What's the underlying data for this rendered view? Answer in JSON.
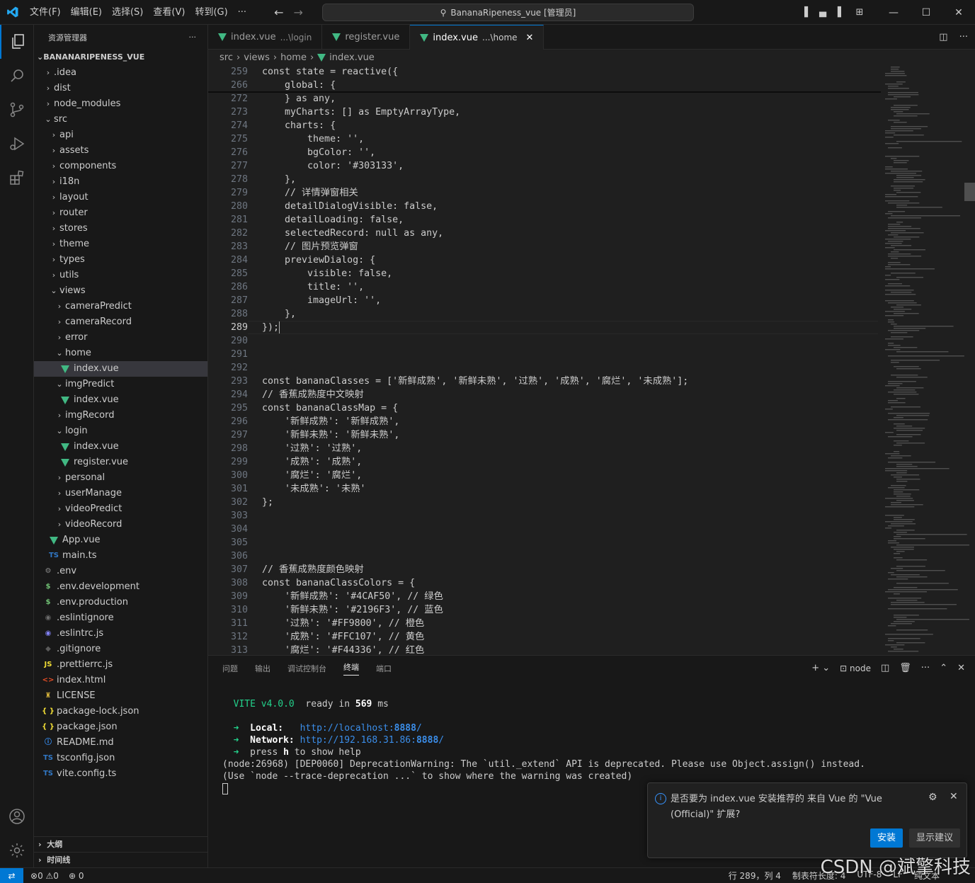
{
  "titlebar": {
    "menus": [
      "文件(F)",
      "编辑(E)",
      "选择(S)",
      "查看(V)",
      "转到(G)",
      "···"
    ],
    "search_text": "BananaRipeness_vue [管理员]"
  },
  "sidebar": {
    "title": "资源管理器",
    "more": "···",
    "root": "BANANARIPENESS_VUE",
    "tree": [
      {
        "label": ".idea",
        "depth": 1,
        "kind": "folder",
        "open": false
      },
      {
        "label": "dist",
        "depth": 1,
        "kind": "folder",
        "open": false
      },
      {
        "label": "node_modules",
        "depth": 1,
        "kind": "folder",
        "open": false
      },
      {
        "label": "src",
        "depth": 1,
        "kind": "folder",
        "open": true
      },
      {
        "label": "api",
        "depth": 2,
        "kind": "folder",
        "open": false
      },
      {
        "label": "assets",
        "depth": 2,
        "kind": "folder",
        "open": false
      },
      {
        "label": "components",
        "depth": 2,
        "kind": "folder",
        "open": false
      },
      {
        "label": "i18n",
        "depth": 2,
        "kind": "folder",
        "open": false
      },
      {
        "label": "layout",
        "depth": 2,
        "kind": "folder",
        "open": false
      },
      {
        "label": "router",
        "depth": 2,
        "kind": "folder",
        "open": false
      },
      {
        "label": "stores",
        "depth": 2,
        "kind": "folder",
        "open": false
      },
      {
        "label": "theme",
        "depth": 2,
        "kind": "folder",
        "open": false
      },
      {
        "label": "types",
        "depth": 2,
        "kind": "folder",
        "open": false
      },
      {
        "label": "utils",
        "depth": 2,
        "kind": "folder",
        "open": false
      },
      {
        "label": "views",
        "depth": 2,
        "kind": "folder",
        "open": true
      },
      {
        "label": "cameraPredict",
        "depth": 3,
        "kind": "folder",
        "open": false
      },
      {
        "label": "cameraRecord",
        "depth": 3,
        "kind": "folder",
        "open": false
      },
      {
        "label": "error",
        "depth": 3,
        "kind": "folder",
        "open": false
      },
      {
        "label": "home",
        "depth": 3,
        "kind": "folder",
        "open": true
      },
      {
        "label": "index.vue",
        "depth": 4,
        "kind": "vue",
        "selected": true
      },
      {
        "label": "imgPredict",
        "depth": 3,
        "kind": "folder",
        "open": true
      },
      {
        "label": "index.vue",
        "depth": 4,
        "kind": "vue"
      },
      {
        "label": "imgRecord",
        "depth": 3,
        "kind": "folder",
        "open": false
      },
      {
        "label": "login",
        "depth": 3,
        "kind": "folder",
        "open": true
      },
      {
        "label": "index.vue",
        "depth": 4,
        "kind": "vue"
      },
      {
        "label": "register.vue",
        "depth": 4,
        "kind": "vue"
      },
      {
        "label": "personal",
        "depth": 3,
        "kind": "folder",
        "open": false
      },
      {
        "label": "userManage",
        "depth": 3,
        "kind": "folder",
        "open": false
      },
      {
        "label": "videoPredict",
        "depth": 3,
        "kind": "folder",
        "open": false
      },
      {
        "label": "videoRecord",
        "depth": 3,
        "kind": "folder",
        "open": false
      },
      {
        "label": "App.vue",
        "depth": 2,
        "kind": "vue"
      },
      {
        "label": "main.ts",
        "depth": 2,
        "kind": "ts"
      },
      {
        "label": ".env",
        "depth": 1,
        "kind": "gear"
      },
      {
        "label": ".env.development",
        "depth": 1,
        "kind": "dollar"
      },
      {
        "label": ".env.production",
        "depth": 1,
        "kind": "dollar"
      },
      {
        "label": ".eslintignore",
        "depth": 1,
        "kind": "circle"
      },
      {
        "label": ".eslintrc.js",
        "depth": 1,
        "kind": "eslint"
      },
      {
        "label": ".gitignore",
        "depth": 1,
        "kind": "git"
      },
      {
        "label": ".prettierrc.js",
        "depth": 1,
        "kind": "js"
      },
      {
        "label": "index.html",
        "depth": 1,
        "kind": "html"
      },
      {
        "label": "LICENSE",
        "depth": 1,
        "kind": "license"
      },
      {
        "label": "package-lock.json",
        "depth": 1,
        "kind": "json"
      },
      {
        "label": "package.json",
        "depth": 1,
        "kind": "json"
      },
      {
        "label": "README.md",
        "depth": 1,
        "kind": "info"
      },
      {
        "label": "tsconfig.json",
        "depth": 1,
        "kind": "tsconfig"
      },
      {
        "label": "vite.config.ts",
        "depth": 1,
        "kind": "ts"
      }
    ],
    "outline": "大纲",
    "timeline": "时间线"
  },
  "tabs": [
    {
      "name": "index.vue",
      "hint": "...\\login",
      "active": false
    },
    {
      "name": "register.vue",
      "hint": "",
      "active": false
    },
    {
      "name": "index.vue",
      "hint": "...\\home",
      "active": true
    }
  ],
  "breadcrumb": [
    "src",
    "views",
    "home",
    "index.vue"
  ],
  "code": {
    "current_line": 289,
    "lines": [
      {
        "n": 259,
        "t": "const state = reactive({"
      },
      {
        "n": 266,
        "t": "    global: {"
      },
      {
        "n": 272,
        "t": "    } as any,"
      },
      {
        "n": 273,
        "t": "    myCharts: [] as EmptyArrayType,"
      },
      {
        "n": 274,
        "t": "    charts: {"
      },
      {
        "n": 275,
        "t": "        theme: '',"
      },
      {
        "n": 276,
        "t": "        bgColor: '',"
      },
      {
        "n": 277,
        "t": "        color: '#303133',"
      },
      {
        "n": 278,
        "t": "    },"
      },
      {
        "n": 279,
        "t": "    // 详情弹窗相关"
      },
      {
        "n": 280,
        "t": "    detailDialogVisible: false,"
      },
      {
        "n": 281,
        "t": "    detailLoading: false,"
      },
      {
        "n": 282,
        "t": "    selectedRecord: null as any,"
      },
      {
        "n": 283,
        "t": "    // 图片预览弹窗"
      },
      {
        "n": 284,
        "t": "    previewDialog: {"
      },
      {
        "n": 285,
        "t": "        visible: false,"
      },
      {
        "n": 286,
        "t": "        title: '',"
      },
      {
        "n": 287,
        "t": "        imageUrl: '',"
      },
      {
        "n": 288,
        "t": "    },"
      },
      {
        "n": 289,
        "t": "});"
      },
      {
        "n": 290,
        "t": ""
      },
      {
        "n": 291,
        "t": ""
      },
      {
        "n": 292,
        "t": ""
      },
      {
        "n": 293,
        "t": "const bananaClasses = ['新鲜成熟', '新鲜未熟', '过熟', '成熟', '腐烂', '未成熟'];"
      },
      {
        "n": 294,
        "t": "// 香蕉成熟度中文映射"
      },
      {
        "n": 295,
        "t": "const bananaClassMap = {"
      },
      {
        "n": 296,
        "t": "    '新鲜成熟': '新鲜成熟',"
      },
      {
        "n": 297,
        "t": "    '新鲜未熟': '新鲜未熟',"
      },
      {
        "n": 298,
        "t": "    '过熟': '过熟',"
      },
      {
        "n": 299,
        "t": "    '成熟': '成熟',"
      },
      {
        "n": 300,
        "t": "    '腐烂': '腐烂',"
      },
      {
        "n": 301,
        "t": "    '未成熟': '未熟'"
      },
      {
        "n": 302,
        "t": "};"
      },
      {
        "n": 303,
        "t": ""
      },
      {
        "n": 304,
        "t": ""
      },
      {
        "n": 305,
        "t": ""
      },
      {
        "n": 306,
        "t": ""
      },
      {
        "n": 307,
        "t": "// 香蕉成熟度颜色映射"
      },
      {
        "n": 308,
        "t": "const bananaClassColors = {"
      },
      {
        "n": 309,
        "t": "    '新鲜成熟': '#4CAF50', // 绿色"
      },
      {
        "n": 310,
        "t": "    '新鲜未熟': '#2196F3', // 蓝色"
      },
      {
        "n": 311,
        "t": "    '过熟': '#FF9800', // 橙色"
      },
      {
        "n": 312,
        "t": "    '成熟': '#FFC107', // 黄色"
      },
      {
        "n": 313,
        "t": "    '腐烂': '#F44336', // 红色"
      }
    ]
  },
  "panel": {
    "tabs": [
      "问题",
      "输出",
      "调试控制台",
      "终端",
      "端口"
    ],
    "active_tab": "终端",
    "terminal_name": "node",
    "terminal": {
      "vite_name": "VITE",
      "vite_version": "v4.0.0",
      "ready_text": "ready in",
      "ready_ms": "569",
      "ready_unit": "ms",
      "local_label": "Local:",
      "local_url_prefix": "http://localhost:",
      "local_port": "8888",
      "local_url_suffix": "/",
      "network_label": "Network:",
      "network_url_prefix": "http://192.168.31.86:",
      "network_port": "8888",
      "network_url_suffix": "/",
      "press_prefix": "press",
      "press_key": "h",
      "press_suffix": "to show help",
      "warning1": "(node:26968) [DEP0060] DeprecationWarning: The `util._extend` API is deprecated. Please use Object.assign() instead.",
      "warning2": "(Use `node --trace-deprecation ...` to show where the warning was created)"
    }
  },
  "notification": {
    "message": "是否要为 index.vue 安装推荐的 来自 Vue 的 \"Vue (Official)\" 扩展?",
    "install": "安装",
    "show_recommendations": "显示建议"
  },
  "statusbar": {
    "errors": "0",
    "warnings": "0",
    "ports": "0",
    "position": "行 289，列 4",
    "tab_size": "制表符长度: 4",
    "encoding": "UTF-8",
    "eol": "LF",
    "language": "纯文本"
  },
  "watermark": "CSDN @斌擎科技",
  "colors": {
    "accent": "#0078d4",
    "vue_green": "#41b883",
    "terminal_green": "#23d18b",
    "link": "#3b8eea"
  }
}
